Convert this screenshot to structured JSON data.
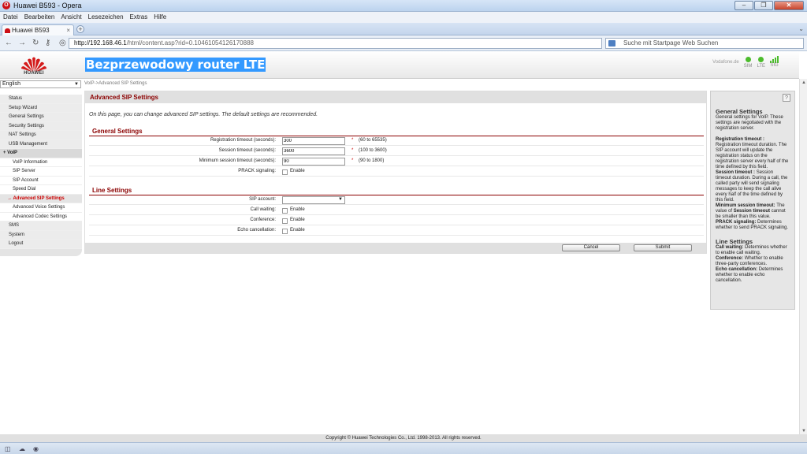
{
  "window": {
    "title": "Huawei B593 - Opera"
  },
  "menu": [
    "Datei",
    "Bearbeiten",
    "Ansicht",
    "Lesezeichen",
    "Extras",
    "Hilfe"
  ],
  "tab": {
    "label": "Huawei B593"
  },
  "address": {
    "host": "http://192.168.46.1",
    "path": "/html/content.asp?rid=0.10461054126170888"
  },
  "search": {
    "placeholder": "Suche mit Startpage Web Suchen"
  },
  "header": {
    "logo_text": "HUAWEI",
    "product_name": "Bezprzewodowy router LTE",
    "provider": "Vodafone.de",
    "sim_label": "SIM",
    "lte_label": "LTE",
    "sig_label": "SIG"
  },
  "language": {
    "selected": "English"
  },
  "breadcrumb": "VoIP->Advanced SIP Settings",
  "sidebar": {
    "items": [
      {
        "label": "Status",
        "kind": "top"
      },
      {
        "label": "Setup Wizard",
        "kind": "top"
      },
      {
        "label": "General Settings",
        "kind": "top"
      },
      {
        "label": "Security Settings",
        "kind": "top"
      },
      {
        "label": "NAT Settings",
        "kind": "top"
      },
      {
        "label": "USB Management",
        "kind": "top"
      },
      {
        "label": "VoIP",
        "kind": "grp"
      },
      {
        "label": "VoIP Information",
        "kind": "sub"
      },
      {
        "label": "SIP Server",
        "kind": "sub"
      },
      {
        "label": "SIP Account",
        "kind": "sub"
      },
      {
        "label": "Speed Dial",
        "kind": "sub"
      },
      {
        "label": "Advanced SIP Settings",
        "kind": "active"
      },
      {
        "label": "Advanced Voice Settings",
        "kind": "sub"
      },
      {
        "label": "Advanced Codec Settings",
        "kind": "sub"
      },
      {
        "label": "SMS",
        "kind": "top"
      },
      {
        "label": "System",
        "kind": "top"
      },
      {
        "label": "Logout",
        "kind": "top"
      }
    ]
  },
  "content": {
    "title": "Advanced SIP Settings",
    "intro": "On this page, you can change advanced SIP settings. The default settings are recommended.",
    "general_heading": "General Settings",
    "reg_label": "Registration timeout (seconds):",
    "reg_value": "300",
    "reg_hint": "(60 to 65535)",
    "sess_label": "Session timeout (seconds):",
    "sess_value": "3600",
    "sess_hint": "(100 to 3600)",
    "min_label": "Minimum session timeout (seconds):",
    "min_value": "90",
    "min_hint": "(90 to 1800)",
    "prack_label": "PRACK signaling:",
    "enable": "Enable",
    "line_heading": "Line Settings",
    "sip_account_label": "SIP account:",
    "call_waiting_label": "Call waiting:",
    "conference_label": "Conference:",
    "echo_label": "Echo cancellation:",
    "required_mark": "*",
    "cancel_label": "Cancel",
    "submit_label": "Submit"
  },
  "help": {
    "general_title": "General Settings",
    "general_text": "General settings for VoIP. These settings are negotiated with the registration server.",
    "reg_title": "Registration timeout :",
    "reg_text": "Registration timeout duration. The SIP account will update the registration status on the registration server every half of the time defined by this field.",
    "sess_title": "Session timeout :",
    "sess_text": "Session timeout duration. During a call, the called party will send signaling messages to keep the call alive every half of the time defined by this field.",
    "min_title": "Minimum session timeout:",
    "min_text_a": "The value of",
    "min_text_b": "Session timeout",
    "min_text_c": "cannot be smaller than this value.",
    "prack_title": "PRACK signaling:",
    "prack_text": "Determines whether to send PRACK signaling.",
    "line_title": "Line Settings",
    "cw_title": "Call waiting:",
    "cw_text": "Determines whether to enable call waiting.",
    "conf_title": "Conference:",
    "conf_text": "Whether to enable three-party conferences.",
    "echo_title": "Echo cancellation:",
    "echo_text": "Determines whether to enable echo cancellation."
  },
  "footer": "Copyright © Huawei Technologies Co., Ltd. 1998-2013. All rights reserved.",
  "colors": {
    "accent": "#8b0000",
    "highlight": "#3399ff",
    "signal": "#4cbc2c"
  }
}
